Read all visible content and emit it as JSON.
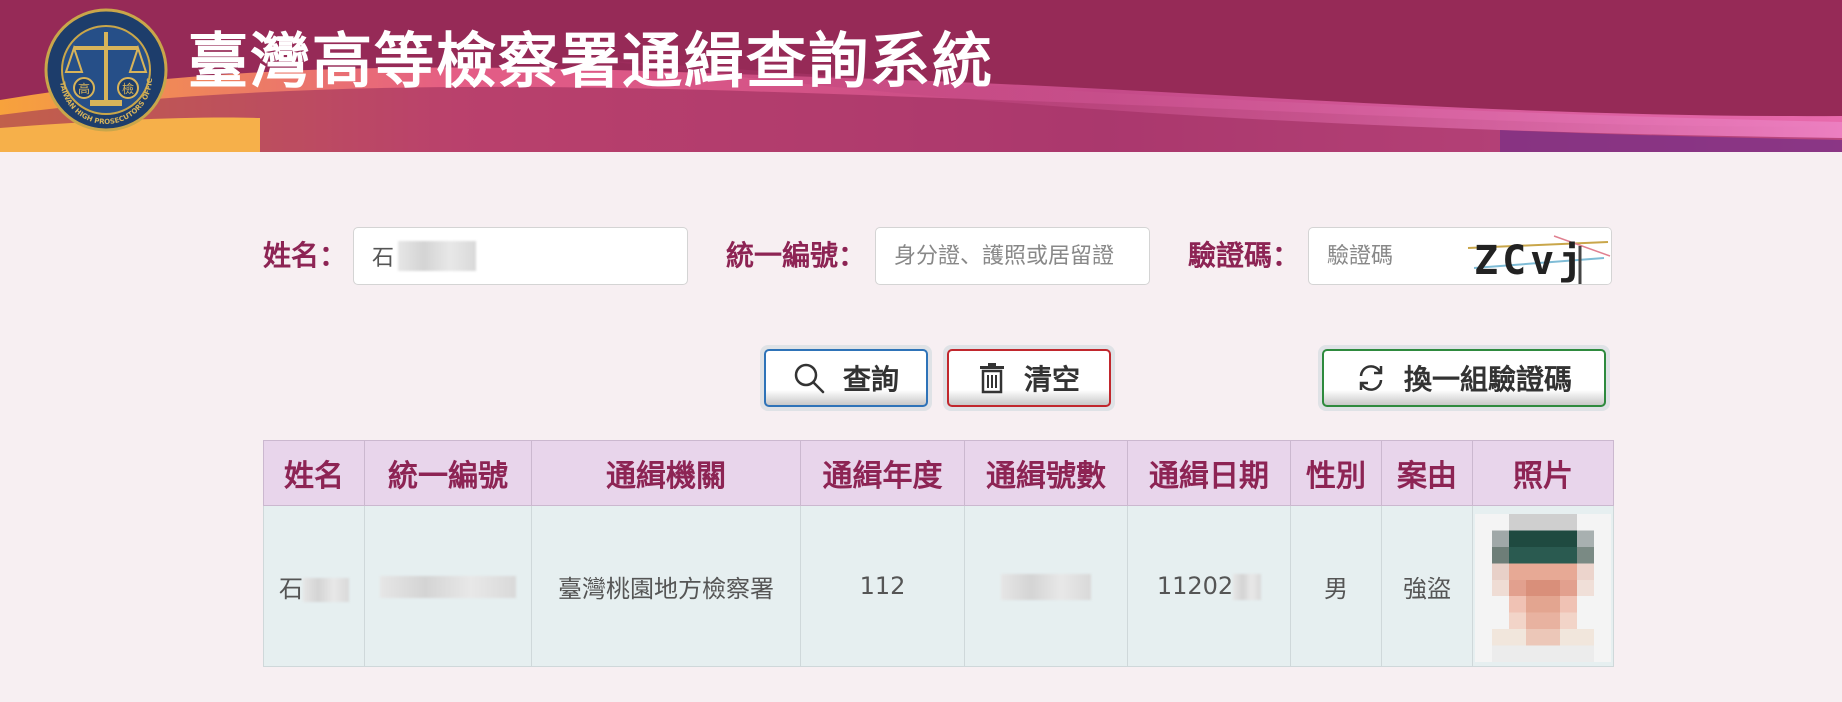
{
  "header": {
    "title": "臺灣高等檢察署通緝查詢系統",
    "logo_text": "TAIWAN HIGH PROSECUTORS OFFICE",
    "logo_char_left": "高",
    "logo_char_right": "檢"
  },
  "form": {
    "name_label": "姓名：",
    "name_value": "石",
    "id_label": "統一編號：",
    "id_placeholder": "身分證、護照或居留證",
    "captcha_label": "驗證碼：",
    "captcha_placeholder": "驗證碼",
    "captcha_text": "ZCvj"
  },
  "buttons": {
    "search_label": "查詢",
    "clear_label": "清空",
    "refresh_label": "換一組驗證碼"
  },
  "table": {
    "headers": [
      "姓名",
      "統一編號",
      "通緝機關",
      "通緝年度",
      "通緝號數",
      "通緝日期",
      "性別",
      "案由",
      "照片"
    ],
    "rows": [
      {
        "name": "石",
        "id_number": "",
        "agency": "臺灣桃園地方檢察署",
        "year": "112",
        "number": "",
        "date": "11202",
        "gender": "男",
        "reason": "強盜"
      }
    ]
  },
  "colors": {
    "brand_maroon": "#962a57",
    "label_maroon": "#8d2454",
    "search_border": "#2e73b8",
    "clear_border": "#c1272d",
    "refresh_border": "#2e8a3e"
  },
  "icons": {
    "search": "magnifier-icon",
    "clear": "trash-icon",
    "refresh": "refresh-icon"
  }
}
